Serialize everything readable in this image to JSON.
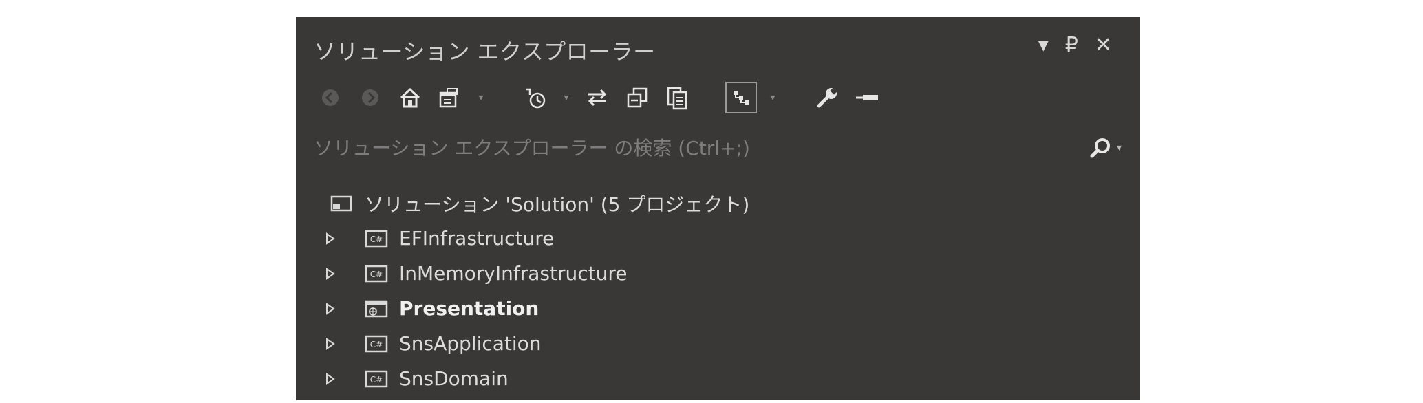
{
  "panel": {
    "title": "ソリューション エクスプローラー",
    "controls": {
      "dropdown_glyph": "▾",
      "pin_glyph": "₽",
      "close_glyph": "✕"
    }
  },
  "search": {
    "placeholder": "ソリューション エクスプローラー の検索 (Ctrl+;)"
  },
  "tree": {
    "root": {
      "label": "ソリューション 'Solution' (5 プロジェクト)"
    },
    "items": [
      {
        "label": "EFInfrastructure",
        "icon": "csharp-project-icon",
        "bold": false
      },
      {
        "label": "InMemoryInfrastructure",
        "icon": "csharp-project-icon",
        "bold": false
      },
      {
        "label": "Presentation",
        "icon": "web-project-icon",
        "bold": true
      },
      {
        "label": "SnsApplication",
        "icon": "csharp-project-icon",
        "bold": false
      },
      {
        "label": "SnsDomain",
        "icon": "csharp-project-icon",
        "bold": false
      }
    ]
  },
  "colors": {
    "panel_bg": "#3a3836",
    "text": "#dcdcdc",
    "muted": "#7d7d7d"
  }
}
